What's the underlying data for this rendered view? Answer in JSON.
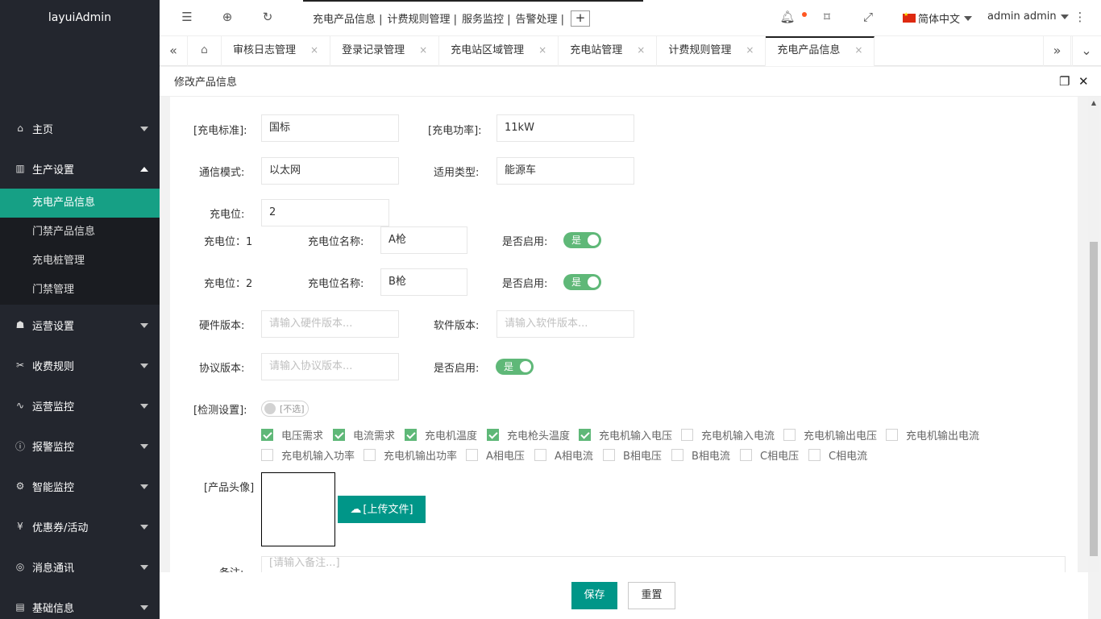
{
  "app": {
    "logo": "layuiAdmin"
  },
  "sidebar": {
    "items": [
      {
        "label": "主页",
        "icon": "home-icon"
      },
      {
        "label": "生产设置",
        "icon": "factory-icon"
      },
      {
        "label": "运营设置",
        "icon": "settings-icon"
      },
      {
        "label": "收费规则",
        "icon": "fee-icon"
      },
      {
        "label": "运营监控",
        "icon": "pulse-icon"
      },
      {
        "label": "报警监控",
        "icon": "alarm-icon"
      },
      {
        "label": "智能监控",
        "icon": "smart-icon"
      },
      {
        "label": "优惠券/活动",
        "icon": "coupon-icon"
      },
      {
        "label": "消息通讯",
        "icon": "message-icon"
      },
      {
        "label": "基础信息",
        "icon": "info-icon"
      }
    ],
    "subitems": [
      {
        "label": "充电产品信息",
        "active": true
      },
      {
        "label": "门禁产品信息"
      },
      {
        "label": "充电桩管理"
      },
      {
        "label": "门禁管理"
      }
    ]
  },
  "header": {
    "top_nav": [
      "充电产品信息 |",
      "计费规则管理 |",
      "服务监控 |",
      "告警处理 |"
    ],
    "plus": "+",
    "language": "简体中文",
    "user": "admin admin"
  },
  "tabs": {
    "items": [
      {
        "label": "审核日志管理"
      },
      {
        "label": "登录记录管理"
      },
      {
        "label": "充电站区域管理"
      },
      {
        "label": "充电站管理"
      },
      {
        "label": "计费规则管理"
      },
      {
        "label": "充电产品信息",
        "active": true
      }
    ],
    "close": "×"
  },
  "dialog": {
    "title": "修改产品信息"
  },
  "form": {
    "standard_label": "[充电标准]:",
    "standard_value": "国标",
    "power_label": "[充电功率]:",
    "power_value": "11kW",
    "comm_label": "通信模式:",
    "comm_value": "以太网",
    "type_label": "适用类型:",
    "type_value": "能源车",
    "slots_label": "充电位:",
    "slots_value": "2",
    "slot_rows": [
      {
        "slot": "充电位：1",
        "name_label": "充电位名称:",
        "name_value": "A枪",
        "enabled_label": "是否启用:",
        "enabled_text": "是"
      },
      {
        "slot": "充电位：2",
        "name_label": "充电位名称:",
        "name_value": "B枪",
        "enabled_label": "是否启用:",
        "enabled_text": "是"
      }
    ],
    "hw_label": "硬件版本:",
    "hw_placeholder": "请输入硬件版本...",
    "sw_label": "软件版本:",
    "sw_placeholder": "请输入软件版本...",
    "proto_label": "协议版本:",
    "proto_placeholder": "请输入协议版本...",
    "enabled_label": "是否启用:",
    "enabled_text": "是",
    "detect_label": "[检测设置]:",
    "detect_switch": "[不选]",
    "checks": [
      {
        "label": "电压需求",
        "checked": true
      },
      {
        "label": "电流需求",
        "checked": true
      },
      {
        "label": "充电机温度",
        "checked": true
      },
      {
        "label": "充电枪头温度",
        "checked": true
      },
      {
        "label": "充电机输入电压",
        "checked": true
      },
      {
        "label": "充电机输入电流",
        "checked": false
      },
      {
        "label": "充电机输出电压",
        "checked": false
      },
      {
        "label": "充电机输出电流",
        "checked": false
      },
      {
        "label": "充电机输入功率",
        "checked": false
      },
      {
        "label": "充电机输出功率",
        "checked": false
      },
      {
        "label": "A相电压",
        "checked": false
      },
      {
        "label": "A相电流",
        "checked": false
      },
      {
        "label": "B相电压",
        "checked": false
      },
      {
        "label": "B相电流",
        "checked": false
      },
      {
        "label": "C相电压",
        "checked": false
      },
      {
        "label": "C相电流",
        "checked": false
      }
    ],
    "avatar_label": "[产品头像]",
    "upload_label": "[上传文件]",
    "remark_label": "备注:",
    "remark_placeholder": "[请输入备注...]"
  },
  "footer": {
    "save": "保存",
    "reset": "重置"
  },
  "colors": {
    "accent": "#009688",
    "switch_on": "#5fb878",
    "sidebar": "#23262e"
  }
}
